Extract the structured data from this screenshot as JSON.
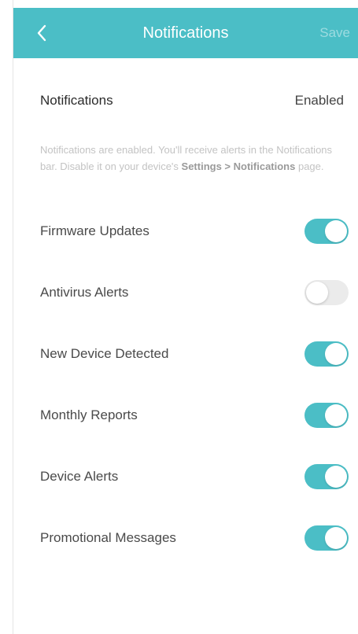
{
  "header": {
    "title": "Notifications",
    "save_label": "Save",
    "accent_color": "#4bbec6"
  },
  "notifications_row": {
    "label": "Notifications",
    "value": "Enabled"
  },
  "note": {
    "text_before": "Notifications are enabled. You'll receive alerts in the Notifications bar. Disable it on your device's ",
    "path": "Settings > Notifications",
    "text_after": " page."
  },
  "toggles": [
    {
      "label": "Firmware Updates",
      "on": true
    },
    {
      "label": "Antivirus Alerts",
      "on": false
    },
    {
      "label": "New Device Detected",
      "on": true
    },
    {
      "label": "Monthly Reports",
      "on": true
    },
    {
      "label": "Device Alerts",
      "on": true
    },
    {
      "label": "Promotional Messages",
      "on": true
    }
  ]
}
